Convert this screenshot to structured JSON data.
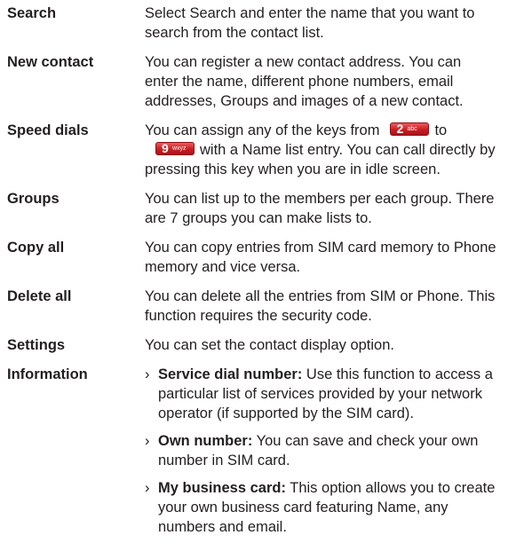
{
  "entries": [
    {
      "term": "Search",
      "desc": "Select Search and enter the name that you want to search from the contact list."
    },
    {
      "term": "New contact",
      "desc": "You can register a new contact address. You can enter the name, different phone numbers, email addresses, Groups and images of a new contact."
    },
    {
      "term": "Speed dials",
      "desc_before": "You can assign any of the keys from",
      "key_from": {
        "num": "2",
        "sub": "abc"
      },
      "desc_middle": "to",
      "key_to": {
        "num": "9",
        "sub": "wxyz"
      },
      "desc_after": "with a Name list entry. You can call directly by pressing this key when you are in idle screen."
    },
    {
      "term": "Groups",
      "desc": "You can list up to the members per each group. There are 7 groups you can make lists to."
    },
    {
      "term": "Copy all",
      "desc": "You can copy entries from SIM card memory to Phone memory and vice versa."
    },
    {
      "term": "Delete all",
      "desc": "You can delete all the entries from SIM or Phone. This function requires the security code."
    },
    {
      "term": "Settings",
      "desc": "You can set the contact display option."
    },
    {
      "term": "Information",
      "bullets": [
        {
          "marker": "›",
          "label": "Service dial number:",
          "text": "Use this function to access a particular list of services provided by your network operator (if supported by the SIM card)."
        },
        {
          "marker": "›",
          "label": "Own number:",
          "text": "You can save and check your own number in SIM card."
        },
        {
          "marker": "›",
          "label": "My business card:",
          "text": "This option allows you to create your own business card featuring Name, any numbers and email."
        }
      ]
    }
  ],
  "colors": {
    "text": "#231f20",
    "key_red": "#c81e24"
  }
}
